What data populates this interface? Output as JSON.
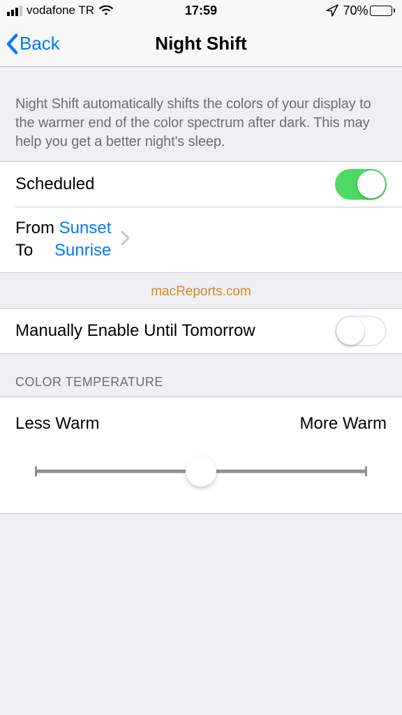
{
  "status": {
    "carrier": "vodafone TR",
    "time": "17:59",
    "battery_percent": "70%"
  },
  "nav": {
    "back_label": "Back",
    "title": "Night Shift"
  },
  "description": "Night Shift automatically shifts the colors of your display to the warmer end of the color spectrum after dark. This may help you get a better night's sleep.",
  "scheduled": {
    "label": "Scheduled",
    "enabled": true,
    "from_label": "From",
    "to_label": "To",
    "from_value": "Sunset",
    "to_value": "Sunrise"
  },
  "watermark": "macReports.com",
  "manual": {
    "label": "Manually Enable Until Tomorrow",
    "enabled": false
  },
  "temperature": {
    "header": "COLOR TEMPERATURE",
    "less_label": "Less Warm",
    "more_label": "More Warm",
    "value_percent": 50
  }
}
